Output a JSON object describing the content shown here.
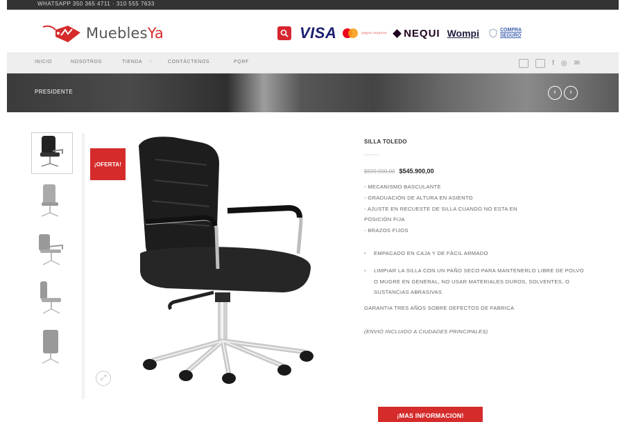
{
  "topbar": {
    "text": "WHATSAPP 350 365 4711 · 310 555 7633"
  },
  "header": {
    "logo_text_a": "Muebles",
    "logo_text_b": "Ya"
  },
  "payments": {
    "visa": "VISA",
    "pse": "pagos seguros",
    "nequi": "NEQUI",
    "wompi": "Wompi",
    "compra_line1": "COMPRA",
    "compra_line2": "SEGURO"
  },
  "nav": {
    "items": [
      "INICIO",
      "NOSOTROS",
      "TIENDA",
      "CONTÁCTENOS",
      "PQRF"
    ]
  },
  "banner": {
    "title": "PRESIDENTE",
    "prev": "‹",
    "next": "›"
  },
  "product": {
    "badge": "¡OFERTA!",
    "name": "SILLA TOLEDO",
    "old_price": "$599.900,00",
    "new_price": "$545.900,00",
    "features": [
      "- MECANISMO BASCULANTE",
      "- GRADUACIÓN DE ALTURA EN ASIENTO",
      "- AJUSTE EN RECUESTE DE SILLA CUANDO NO ESTA EN",
      "POSICIÓN FIJA",
      "- BRAZOS FIJOS"
    ],
    "bullets": [
      "EMPACADO EN CAJA Y DE FÁCIL ARMADO",
      "LIMPIAR LA SILLA CON UN PAÑO SECO PARA MANTENERLO LIBRE DE POLVO O MUGRE EN GENERAL, NO USAR MATERIALES DUROS, SOLVENTES, O SUSTANCIAS ABRASIVAS"
    ],
    "guarantee": "GARANTIA TRES AÑOS SOBRE DEFECTOS DE FABRICA",
    "shipping": "(ENVIÓ INCLUIDO A CIUDADES PRINCIPALES)",
    "cta": "¡MAS INFORMACION!"
  }
}
